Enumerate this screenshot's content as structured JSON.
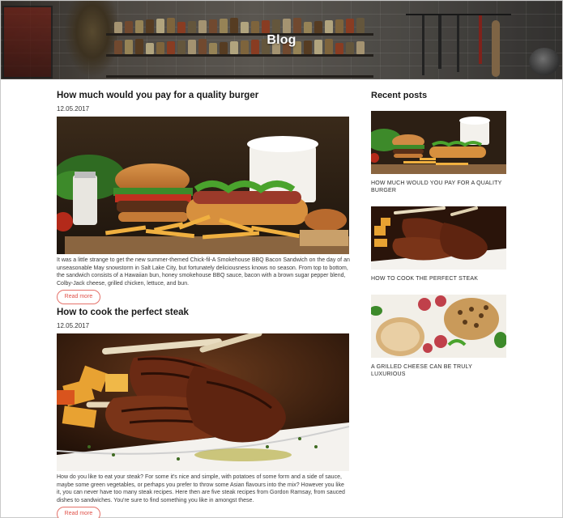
{
  "hero": {
    "title": "Blog"
  },
  "posts": [
    {
      "title": "How much would you pay for a quality burger",
      "date": "12.05.2017",
      "image": "burger-and-hotdog-photo",
      "excerpt": "It was a little strange to get the new summer-themed Chick-fil-A Smokehouse BBQ Bacon Sandwich on the day of an unseasonable May snowstorm in Salt Lake City, but fortunately deliciousness knows no season. From top to bottom, the sandwich consists of a Hawaiian bun, honey smokehouse BBQ sauce, bacon with a brown sugar pepper blend, Colby-Jack cheese, grilled chicken, lettuce, and bun.",
      "read_more": "Read more"
    },
    {
      "title": "How to cook the perfect steak",
      "date": "12.05.2017",
      "image": "grilled-steak-photo",
      "excerpt": "How do you like to eat your steak? For some it's nice and simple, with potatoes of some form and a side of sauce, maybe some green vegetables, or perhaps you prefer to throw some Asian flavours into the mix? However you like it, you can never have too many steak recipes. Here then are five steak recipes from Gordon Ramsay, from sauced dishes to sandwiches. You're sure to find something you like in amongst these.",
      "read_more": "Read more"
    }
  ],
  "sidebar": {
    "title": "Recent posts",
    "items": [
      {
        "caption": "HOW MUCH WOULD YOU PAY FOR A QUALITY BURGER",
        "image": "burger-thumbnail"
      },
      {
        "caption": "HOW TO COOK THE PERFECT STEAK",
        "image": "steak-thumbnail"
      },
      {
        "caption": "A GRILLED CHEESE CAN BE TRULY LUXURIOUS",
        "image": "sandwich-thumbnail"
      }
    ]
  },
  "colors": {
    "accent": "#e0524a",
    "text": "#1a1a1a"
  }
}
